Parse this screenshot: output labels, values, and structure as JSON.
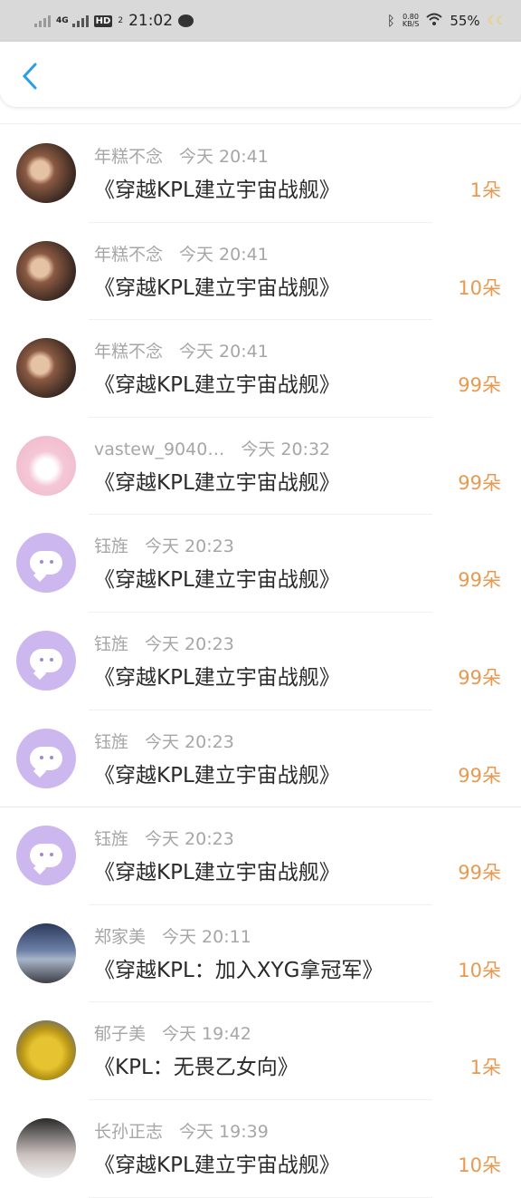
{
  "status_bar": {
    "network": "4G",
    "hd": "HD",
    "hd_sub": "2",
    "time": "21:02",
    "speed_value": "0.80",
    "speed_unit": "KB/S",
    "battery": "55%"
  },
  "header": {
    "back_glyph": "‹"
  },
  "items": [
    {
      "name": "年糕不念",
      "time": "今天 20:41",
      "title": "《穿越KPL建立宇宙战舰》",
      "amount": "1朵",
      "avatar": "photo"
    },
    {
      "name": "年糕不念",
      "time": "今天 20:41",
      "title": "《穿越KPL建立宇宙战舰》",
      "amount": "10朵",
      "avatar": "photo"
    },
    {
      "name": "年糕不念",
      "time": "今天 20:41",
      "title": "《穿越KPL建立宇宙战舰》",
      "amount": "99朵",
      "avatar": "photo"
    },
    {
      "name": "vastew_9040…",
      "time": "今天 20:32",
      "title": "《穿越KPL建立宇宙战舰》",
      "amount": "99朵",
      "avatar": "pink"
    },
    {
      "name": "钰旌",
      "time": "今天 20:23",
      "title": "《穿越KPL建立宇宙战舰》",
      "amount": "99朵",
      "avatar": "lilac"
    },
    {
      "name": "钰旌",
      "time": "今天 20:23",
      "title": "《穿越KPL建立宇宙战舰》",
      "amount": "99朵",
      "avatar": "lilac"
    },
    {
      "name": "钰旌",
      "time": "今天 20:23",
      "title": "《穿越KPL建立宇宙战舰》",
      "amount": "99朵",
      "avatar": "lilac"
    },
    {
      "name": "钰旌",
      "time": "今天 20:23",
      "title": "《穿越KPL建立宇宙战舰》",
      "amount": "99朵",
      "avatar": "lilac"
    },
    {
      "name": "郑家美",
      "time": "今天 20:11",
      "title": "《穿越KPL：加入XYG拿冠军》",
      "amount": "10朵",
      "avatar": "sky"
    },
    {
      "name": "郁子美",
      "time": "今天 19:42",
      "title": "《KPL：无畏乙女向》",
      "amount": "1朵",
      "avatar": "yellow"
    },
    {
      "name": "长孙正志",
      "time": "今天 19:39",
      "title": "《穿越KPL建立宇宙战舰》",
      "amount": "10朵",
      "avatar": "dark"
    }
  ]
}
